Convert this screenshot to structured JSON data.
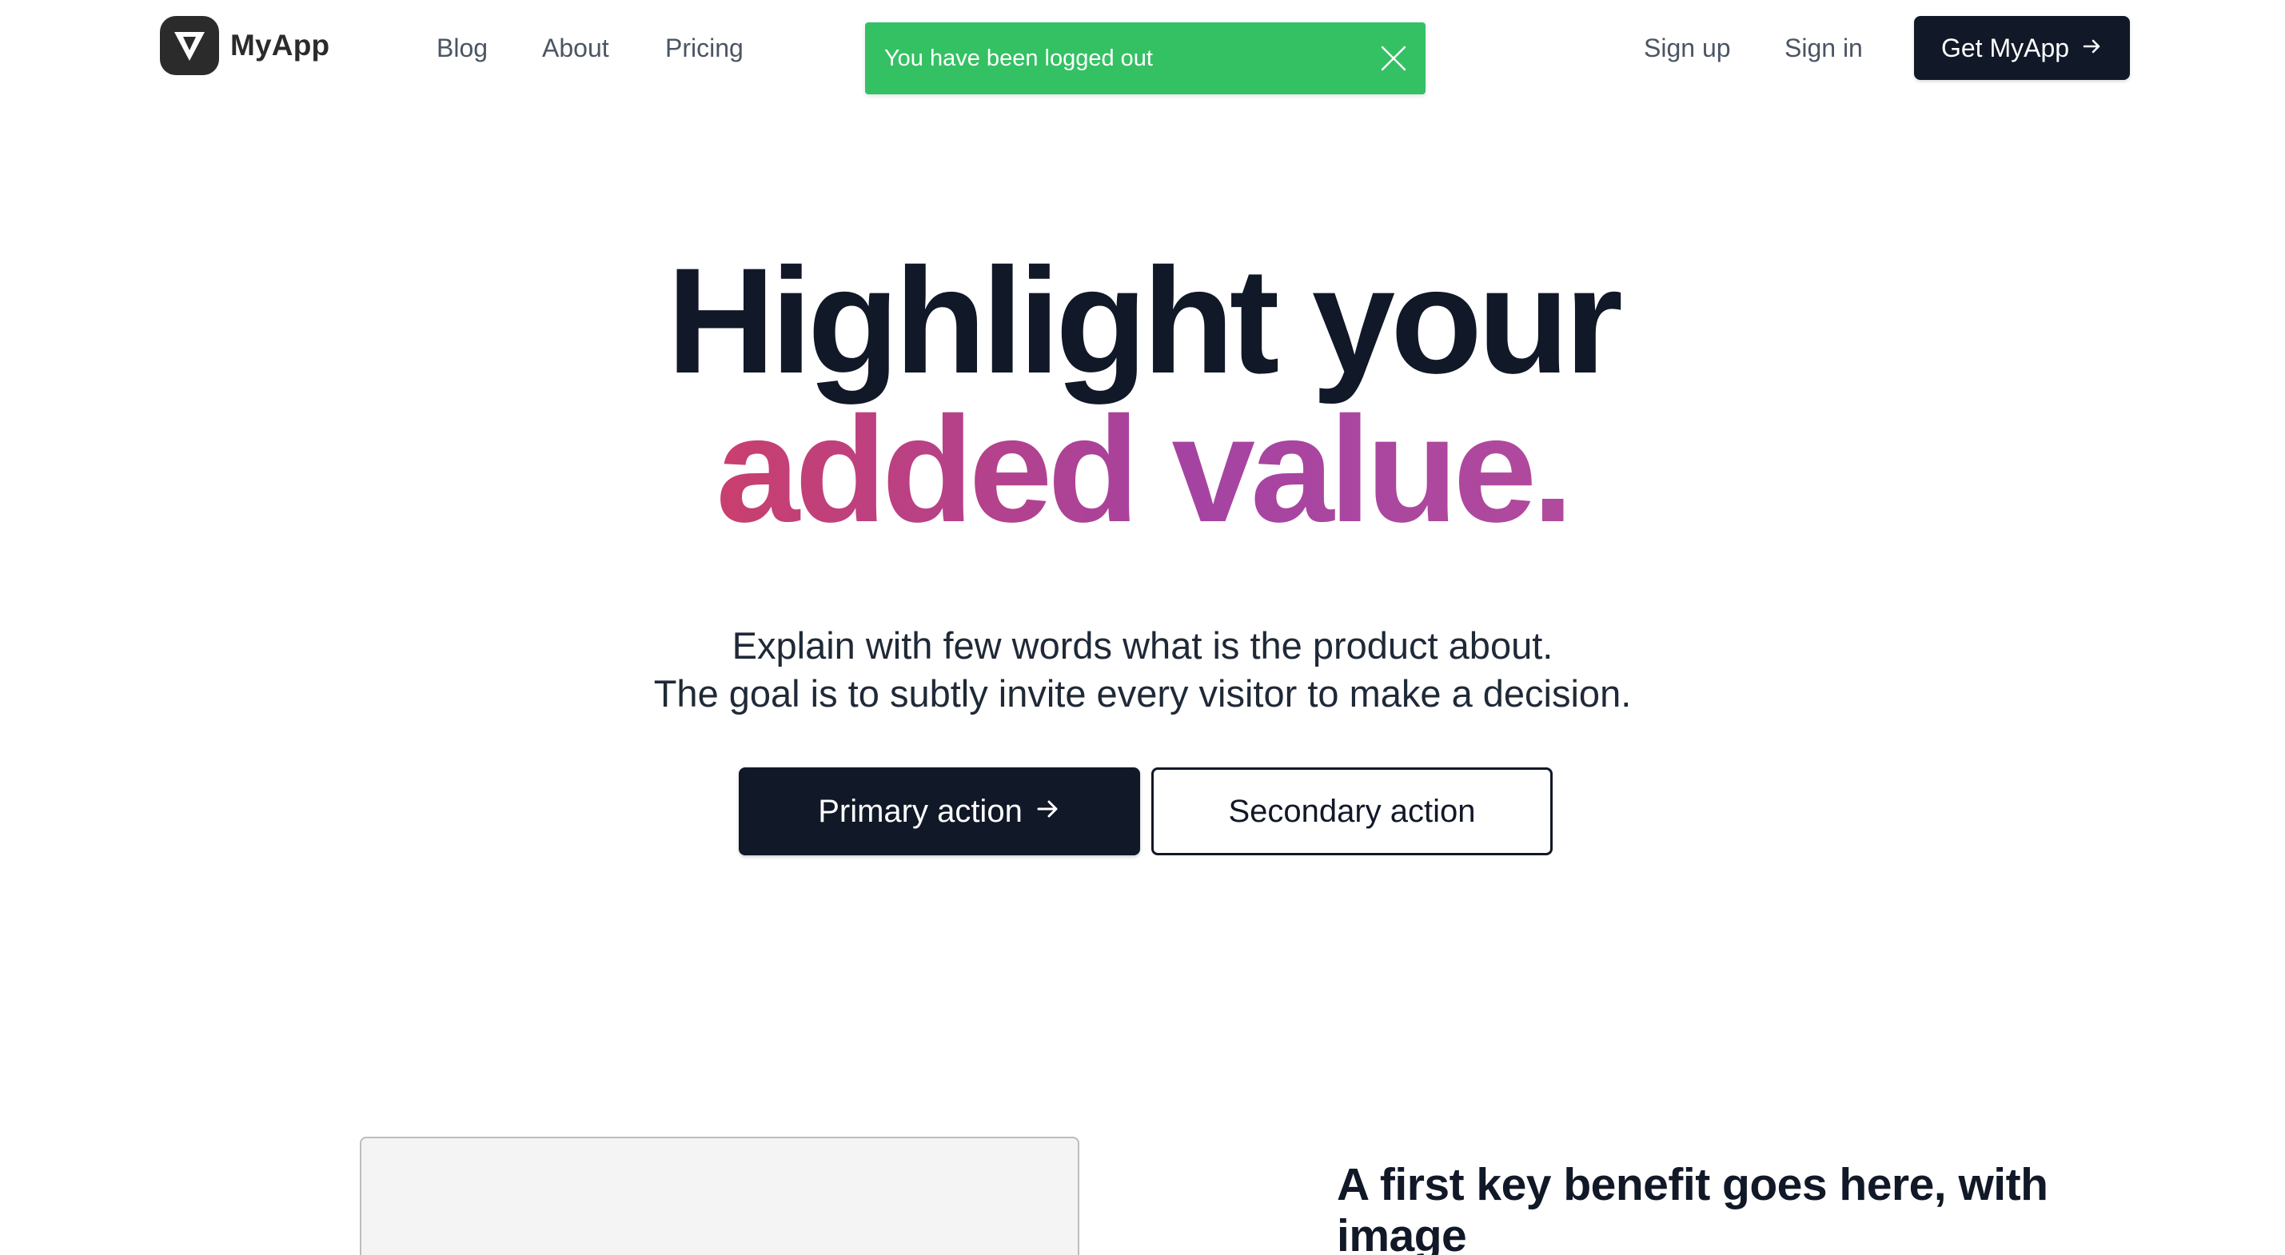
{
  "header": {
    "logo_text": "MyApp",
    "logo_icon": "v-logo-icon",
    "nav": {
      "blog": "Blog",
      "about": "About",
      "pricing": "Pricing"
    },
    "sign_up": "Sign up",
    "sign_in": "Sign in",
    "cta_label": "Get MyApp",
    "cta_icon": "arrow-right-icon"
  },
  "toast": {
    "message": "You have been logged out",
    "close_icon": "close-icon",
    "color": "#34c163"
  },
  "hero": {
    "title_line1": "Highlight your",
    "title_line2": "added value.",
    "subtitle_line1": "Explain with few words what is the product about.",
    "subtitle_line2": "The goal is to subtly invite every visitor to make a decision.",
    "primary_action": "Primary action",
    "secondary_action": "Secondary action"
  },
  "feature": {
    "title": "A first key benefit goes here, with image"
  },
  "colors": {
    "dark": "#111827",
    "gradient_start": "#c93f6e",
    "gradient_end": "#a543a2"
  }
}
